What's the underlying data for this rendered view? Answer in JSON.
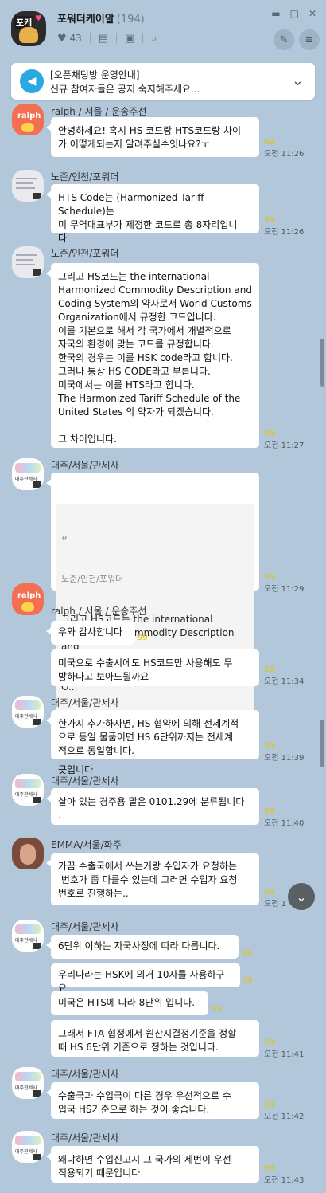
{
  "room": {
    "avatar_label": "포케",
    "title": "포워더케이알",
    "member_count": "(194)",
    "likes": "43"
  },
  "notice": {
    "title": "[오픈채팅방 운영안내]",
    "text": "신규 참여자들은 공지 숙지해주세요..."
  },
  "messages": [
    {
      "sender": "ralph / 서울 / 운송주선",
      "avatar": "ralph",
      "text": "안녕하세요! 혹시 HS 코드랑 HTS코드랑 차이\n가 어떻게되는지 알려주실수잇나요?ㅜ",
      "time": "오전 11:26"
    },
    {
      "sender": "노준/인천/포워더",
      "avatar": "doc",
      "text": "HTS Code는 (Harmonized Tariff Schedule)는\n미 무역대표부가 제정한 코드로 총 8자리입니\n다",
      "time": "오전 11:26"
    },
    {
      "sender": "노준/인천/포워더",
      "avatar": "doc",
      "text": "그리고 HS코드는 the international\nHarmonized Commodity Description and\nCoding System의 약자로서 World Customs\nOrganization에서 규정한 코드입니다.\n이를 기본으로 해서 각 국가에서 개별적으로\n자국의 환경에 맞는 코드를 규정합니다.\n한국의 경우는 이를 HSK code라고 합니다.\n그러나 통상 HS CODE라고 부릅니다.\n미국에서는 이를 HTS라고 합니다.\nThe Harmonized Tariff Schedule of the\nUnited States 의 약자가 되겠습니다.\n\n그 차이입니다.",
      "time": "오전 11:27"
    },
    {
      "sender": "대주/서울/관세사",
      "avatar": "customs",
      "quote_author": "노준/인천/포워더",
      "quote_text": "그리고 HS코드는 the international\nHarmonized Commodity Description and\nCoding System의 약자로서 World Customs\nO...",
      "text": "긋입니다",
      "time": "오전 11:29"
    },
    {
      "sender": "ralph / 서울 / 운송주선",
      "avatar": "ralph",
      "text": "우와 감사합니다",
      "time": ""
    },
    {
      "sender": "",
      "avatar": "",
      "text": "미국으로 수출시에도 HS코드만 사용해도 무\n방하다고 보아도될까요",
      "time": "오전 11:34"
    },
    {
      "sender": "대주/서울/관세사",
      "avatar": "customs",
      "text": "한가지 추가하자면, HS 협약에 의해 전세계적\n으로 동일 물품이면 HS 6단위까지는 전세계\n적으로 동일합니다.",
      "time": "오전 11:39"
    },
    {
      "sender": "대주/서울/관세사",
      "avatar": "customs",
      "text": "살아 있는 경주용 말은 0101.29에 분류됩니다\n.",
      "time": "오전 11:40"
    },
    {
      "sender": "EMMA/서울/화주",
      "avatar": "emma",
      "text": "가끔 수출국에서 쓰는거랑 수입자가 요청하는\n 번호가 좀 다를수 있는데 그러면 수입자 요청\n번호로 진행하는..",
      "time": "오전 1"
    },
    {
      "sender": "대주/서울/관세사",
      "avatar": "customs",
      "text": "6단위 이하는 자국사정에 따라 다릅니다.",
      "time": ""
    },
    {
      "sender": "",
      "avatar": "",
      "text": "우리나라는 HSK에 의거 10자를 사용하구요",
      "time": ""
    },
    {
      "sender": "",
      "avatar": "",
      "text": "미국은 HTS에 따라 8단위 입니다.",
      "time": ""
    },
    {
      "sender": "",
      "avatar": "",
      "text": "그래서 FTA 협정에서 원산지결정기준을 정할\n때 HS 6단위 기준으로 정하는 것입니다.",
      "time": "오전 11:41"
    },
    {
      "sender": "대주/서울/관세사",
      "avatar": "customs",
      "text": "수출국과 수입국이 다른 경우 우선적으로 수\n입국 HS기준으로 하는 것이 좋습니다.",
      "time": "오전 11:42"
    },
    {
      "sender": "대주/서울/관세사",
      "avatar": "customs",
      "text": "왜냐하면 수입신고시 그 국가의 세번이 우선\n적용되기 때문입니다",
      "time": "오전 11:43"
    }
  ],
  "icons": {
    "heart": "heart-icon",
    "notes": "notes-icon",
    "album": "album-icon",
    "search": "search-icon",
    "notice": "megaphone-icon",
    "chevron": "chevron-down-icon",
    "scroll": "scroll-down-icon"
  },
  "colors": {
    "background": "#b2c7da",
    "bubble": "#ffffff",
    "notice_icon": "#2aa9e0"
  }
}
